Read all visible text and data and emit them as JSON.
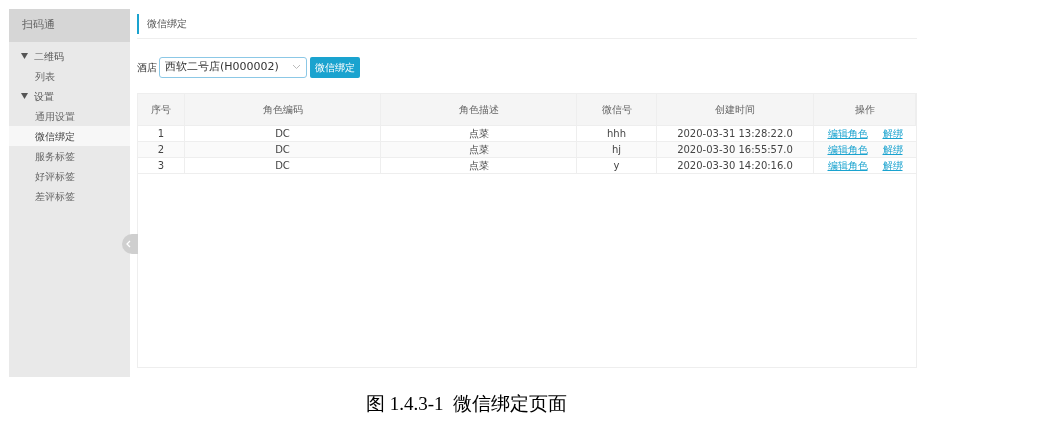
{
  "sidebar": {
    "title": "扫码通",
    "items": [
      {
        "label": "二维码",
        "expanded": true,
        "children": [
          {
            "label": "列表",
            "selected": false
          }
        ]
      },
      {
        "label": "设置",
        "expanded": true,
        "children": [
          {
            "label": "通用设置",
            "selected": false
          },
          {
            "label": "微信绑定",
            "selected": true
          },
          {
            "label": "服务标签",
            "selected": false
          },
          {
            "label": "好评标签",
            "selected": false
          },
          {
            "label": "差评标签",
            "selected": false
          }
        ]
      }
    ]
  },
  "page_title": "微信绑定",
  "filter": {
    "label": "酒店",
    "value": "西软二号店(H000002)",
    "button": "微信绑定"
  },
  "table": {
    "columns": [
      "序号",
      "角色编码",
      "角色描述",
      "微信号",
      "创建时间",
      "操作"
    ],
    "rows": [
      {
        "cells": [
          "1",
          "DC",
          "点菜",
          "hhh",
          "2020-03-31 13:28:22.0"
        ],
        "actions": [
          "编辑角色",
          "解绑"
        ]
      },
      {
        "cells": [
          "2",
          "DC",
          "点菜",
          "hj",
          "2020-03-30 16:55:57.0"
        ],
        "actions": [
          "编辑角色",
          "解绑"
        ]
      },
      {
        "cells": [
          "3",
          "DC",
          "点菜",
          "y",
          "2020-03-30 14:20:16.0"
        ],
        "actions": [
          "编辑角色",
          "解绑"
        ]
      }
    ]
  },
  "caption": "图 1.4.3-1  微信绑定页面"
}
